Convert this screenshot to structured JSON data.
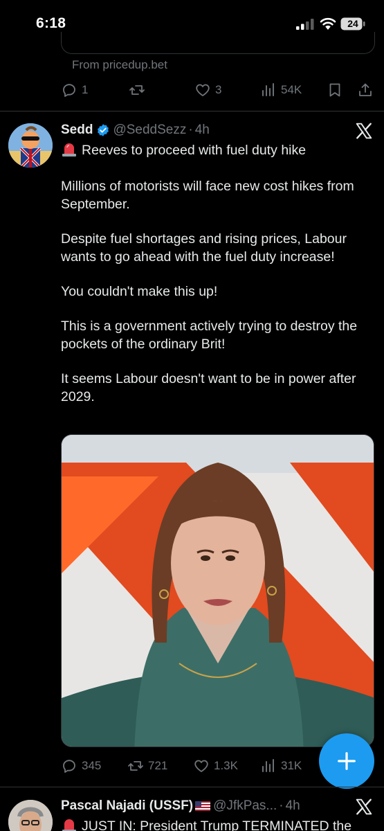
{
  "status_bar": {
    "time": "6:18",
    "battery": "24"
  },
  "previous_tweet": {
    "link_source": "From pricedup.bet",
    "replies": "1",
    "reposts": "",
    "likes": "3",
    "views": "54K"
  },
  "tweet": {
    "author_name": "Sedd",
    "handle": "@SeddSezz",
    "separator": "·",
    "time": "4h",
    "headline": "Reeves to proceed with fuel duty hike",
    "paragraphs": [
      "Millions of motorists will face new cost hikes from September.",
      "Despite fuel shortages and rising prices, Labour wants to go ahead with the fuel duty increase!",
      "You couldn't make this up!",
      "This is a government actively trying to destroy the pockets of the ordinary Brit!",
      "It seems Labour doesn't want to be in power after 2029."
    ],
    "replies": "345",
    "reposts": "721",
    "likes": "1.3K",
    "views": "31K"
  },
  "next_tweet": {
    "author_name": "Pascal Najadi (USSF)",
    "handle": "@JfkPas...",
    "separator": "·",
    "time": "4h",
    "text": "JUST IN: President Trump TERMINATED the"
  },
  "icons": {
    "verified": "verified-badge-icon",
    "brand": "x-logo-icon",
    "compose": "plus-icon",
    "accent_color": "#1d9bf0"
  }
}
